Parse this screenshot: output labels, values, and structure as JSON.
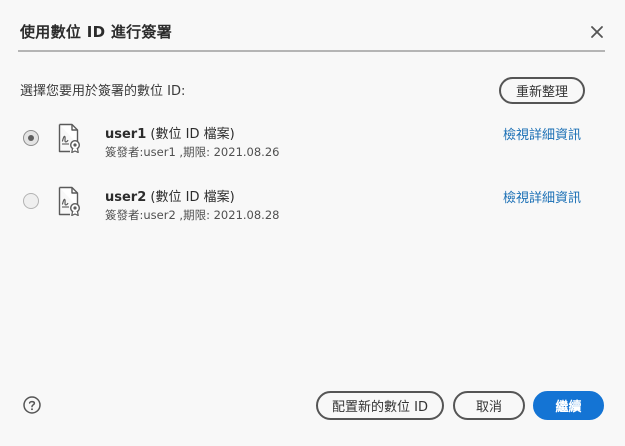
{
  "dialog": {
    "title": "使用數位 ID 進行簽署",
    "prompt": "選擇您要用於簽署的數位 ID:",
    "refresh_label": "重新整理"
  },
  "ids": [
    {
      "name": "user1",
      "type_label": " (數位 ID 檔案)",
      "meta": "簽發者:user1 ,期限: 2021.08.26",
      "details_label": "檢視詳細資訊",
      "selected": true
    },
    {
      "name": "user2",
      "type_label": " (數位 ID 檔案)",
      "meta": "簽發者:user2 ,期限: 2021.08.28",
      "details_label": "檢視詳細資訊",
      "selected": false
    }
  ],
  "footer": {
    "configure_label": "配置新的數位 ID",
    "cancel_label": "取消",
    "continue_label": "繼續"
  },
  "icons": {
    "close": "close-icon",
    "certificate": "certificate-icon",
    "help": "help-icon"
  },
  "colors": {
    "link": "#1a6fb5",
    "primary": "#1474d4",
    "background": "#f8f8f8"
  }
}
